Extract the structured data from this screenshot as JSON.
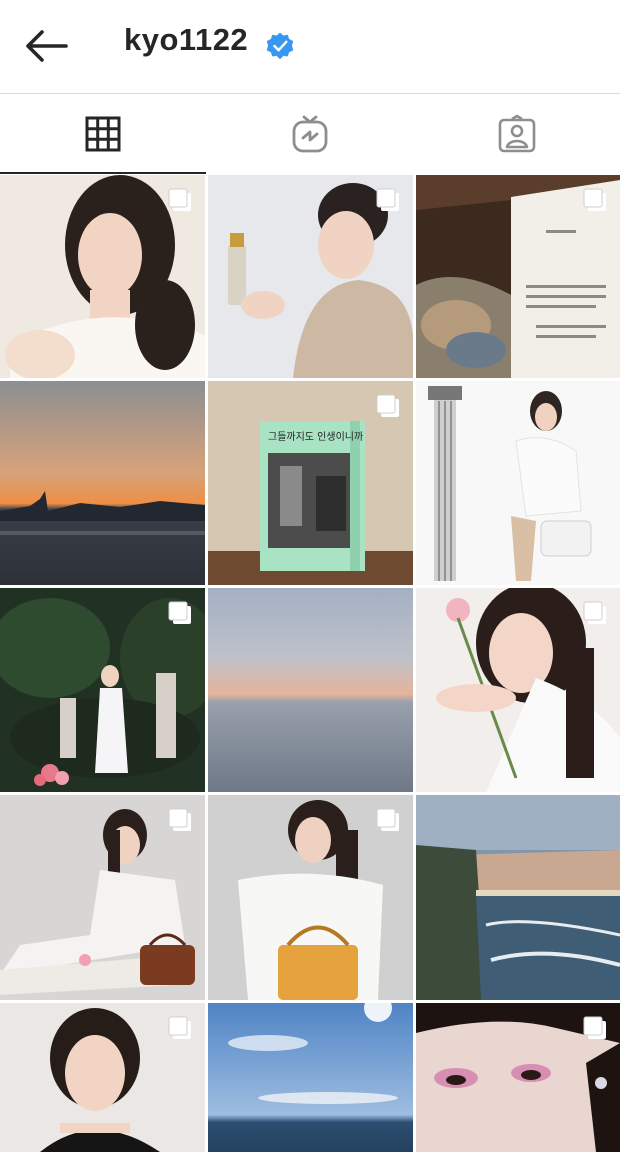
{
  "header": {
    "username": "kyo1122",
    "verified": true,
    "back_icon": "arrow-left-icon",
    "verified_icon": "verified-badge-icon"
  },
  "tabs": [
    {
      "name": "posts-grid",
      "icon": "grid-icon",
      "active": true
    },
    {
      "name": "igtv",
      "icon": "igtv-icon",
      "active": false
    },
    {
      "name": "tagged",
      "icon": "tagged-user-icon",
      "active": false
    }
  ],
  "grid": {
    "columns": 3,
    "posts": [
      {
        "subject": "portrait-white-dress",
        "multi": true
      },
      {
        "subject": "portrait-holding-bottle",
        "multi": true
      },
      {
        "subject": "open-book-painting",
        "multi": true
      },
      {
        "subject": "city-sunset-skyline",
        "multi": false
      },
      {
        "subject": "green-book-cover",
        "multi": true,
        "book_title": "그들까지도 인생이니까"
      },
      {
        "subject": "column-and-seated-woman",
        "multi": false
      },
      {
        "subject": "garden-statues-white-dress",
        "multi": true
      },
      {
        "subject": "ocean-dusk-gradient",
        "multi": false
      },
      {
        "subject": "portrait-with-flower",
        "multi": true
      },
      {
        "subject": "seated-woman-handbag",
        "multi": true
      },
      {
        "subject": "woman-yellow-bag",
        "multi": true
      },
      {
        "subject": "coastal-town-waves",
        "multi": false
      },
      {
        "subject": "portrait-black-top",
        "multi": true
      },
      {
        "subject": "blue-sky-sea",
        "multi": false
      },
      {
        "subject": "closeup-pink-eyeshadow",
        "multi": true
      }
    ]
  },
  "colors": {
    "text": "#262626",
    "verified_blue": "#3897f0",
    "divider": "#dbdbdb",
    "icon_gray": "#8e8e8e"
  }
}
